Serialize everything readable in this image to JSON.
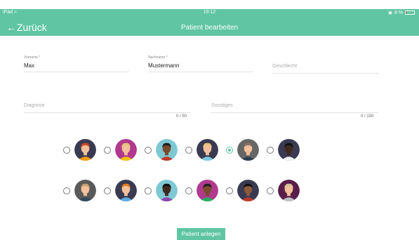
{
  "status_bar": {
    "carrier": "iPad ≈",
    "time": "19:12",
    "battery": "8 %",
    "icons": [
      "wifi-icon",
      "location-icon",
      "battery-icon"
    ]
  },
  "nav": {
    "back_label": "Zurück",
    "back_icon": "arrow-left-icon",
    "title": "Patient bearbeiten"
  },
  "form": {
    "vorname": {
      "label": "Vorname *",
      "value": "Max"
    },
    "nachname": {
      "label": "Nachname *",
      "value": "Mustermann"
    },
    "geschlecht": {
      "placeholder": "Geschlecht"
    },
    "diagnose": {
      "placeholder": "Diagnose",
      "counter": "0 / 50"
    },
    "sonstiges": {
      "placeholder": "Sonstiges",
      "counter": "0 / 150"
    }
  },
  "avatars": {
    "selected_index": 4,
    "row1": [
      {
        "bg": "#3a3a52",
        "skin": "#f2c09a",
        "hair": "#c94a2a",
        "shirt": "#f39c12"
      },
      {
        "bg": "#b13a8e",
        "skin": "#f2c09a",
        "hair": "#e8c27a",
        "shirt": "#f1c40f"
      },
      {
        "bg": "#7ec8d3",
        "skin": "#7a4a2e",
        "hair": "#1e1e1e",
        "shirt": "#c0392b"
      },
      {
        "bg": "#3a3a52",
        "skin": "#f2c09a",
        "hair": "#e8c27a",
        "shirt": "#7ec8e3"
      },
      {
        "bg": "#666666",
        "skin": "#f2c09a",
        "hair": "#8a7060",
        "shirt": "#2c3e50"
      },
      {
        "bg": "#3a3a52",
        "skin": "#3d2a20",
        "hair": "#111111",
        "shirt": "#ecf0f1"
      }
    ],
    "row2": [
      {
        "bg": "#5a5a5a",
        "skin": "#f2c09a",
        "hair": "#c8a070",
        "shirt": "#34495e"
      },
      {
        "bg": "#3a3a52",
        "skin": "#f2c09a",
        "hair": "#e67e22",
        "shirt": "#5dade2"
      },
      {
        "bg": "#7ec8d3",
        "skin": "#3d2a20",
        "hair": "#111111",
        "shirt": "#8e44ad"
      },
      {
        "bg": "#b13a8e",
        "skin": "#7a4a2e",
        "hair": "#1e1e1e",
        "shirt": "#27ae60"
      },
      {
        "bg": "#3a3a52",
        "skin": "#8a5a3a",
        "hair": "#111111",
        "shirt": "#c0392b"
      },
      {
        "bg": "#5a1e4a",
        "skin": "#f2c09a",
        "hair": "#d8c090",
        "shirt": "#bdc3c7"
      }
    ]
  },
  "submit_label": "Patient anlegen",
  "colors": {
    "accent": "#5fc5a3"
  }
}
